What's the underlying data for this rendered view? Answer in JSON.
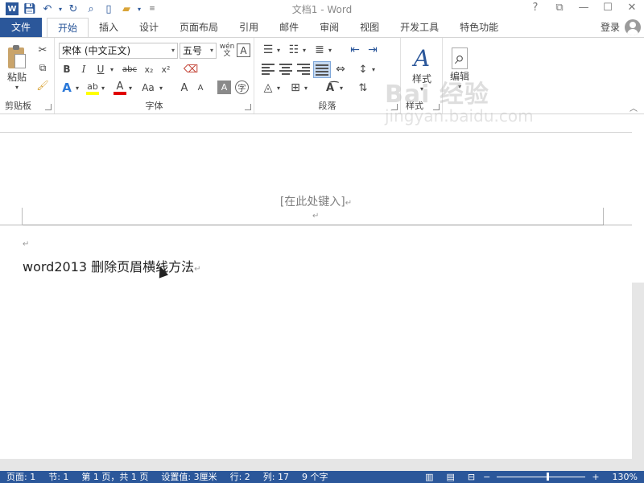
{
  "titlebar": {
    "title": "文档1 - Word",
    "logo": "W",
    "help": "?",
    "restore_ribbon": "⧉",
    "minimize": "—",
    "maximize": "☐",
    "close": "✕"
  },
  "tabs": {
    "file": "文件",
    "items": [
      "开始",
      "插入",
      "设计",
      "页面布局",
      "引用",
      "邮件",
      "审阅",
      "视图",
      "开发工具",
      "特色功能"
    ],
    "active_index": 0,
    "login": "登录"
  },
  "ribbon": {
    "clipboard": {
      "paste": "粘贴",
      "label": "剪贴板"
    },
    "font": {
      "font_name": "宋体 (中文正文)",
      "font_size": "五号",
      "bold": "B",
      "italic": "I",
      "underline": "U",
      "strike": "abc",
      "subscript": "x₂",
      "superscript": "x²",
      "font_color": "A",
      "case": "Aa",
      "grow": "A",
      "shrink": "A",
      "label": "字体"
    },
    "paragraph": {
      "label": "段落"
    },
    "styles": {
      "button": "样式",
      "label": "样式"
    },
    "editing": {
      "button": "编辑"
    }
  },
  "document": {
    "header_placeholder": "[在此处键入]",
    "paragraph_mark": "↵",
    "body_text": "word2013 删除页眉横线方法"
  },
  "watermark": {
    "main": "Bai 经验",
    "sub": "jingyan.baidu.com"
  },
  "statusbar": {
    "page": "页面: 1",
    "section": "节: 1",
    "page_of": "第 1 页，共 1 页",
    "setting": "设置值: 3厘米",
    "line": "行: 2",
    "column": "列: 17",
    "chars": "9 个字",
    "zoom": "130%",
    "zoom_fraction": 0.57
  }
}
